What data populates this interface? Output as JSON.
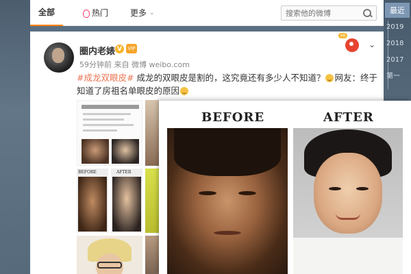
{
  "tabs": [
    {
      "label": "全部",
      "active": true
    },
    {
      "label": "热门",
      "icon": "fire-icon"
    },
    {
      "label": "更多",
      "icon": "chevron-down-icon"
    }
  ],
  "search": {
    "placeholder": "搜索他的微博"
  },
  "years": {
    "latest": "最近",
    "items": [
      "2019",
      "2018",
      "2017"
    ],
    "extra": "第一"
  },
  "post": {
    "user": "圈内老婊",
    "meta": "59分钟前 来自 微博 weibo.com",
    "hashtag": "#成龙双眼皮#",
    "text1": "成龙的双眼皮是割的，这究竟还有多少人不知道？",
    "text2": "网友：终于知道了房祖名单眼皮的原因",
    "v_badge": "V",
    "vip_badge": "VIP",
    "mascot_hi": "HI"
  },
  "thumbs": {
    "before_label": "BEFORE",
    "after_label": "AFTER"
  },
  "compare": {
    "before_label": "BEFORE",
    "after_label": "AFTER"
  },
  "colors": {
    "accent": "#ff8200",
    "hashtag": "#eb7350",
    "latest": "#7d97b3"
  }
}
